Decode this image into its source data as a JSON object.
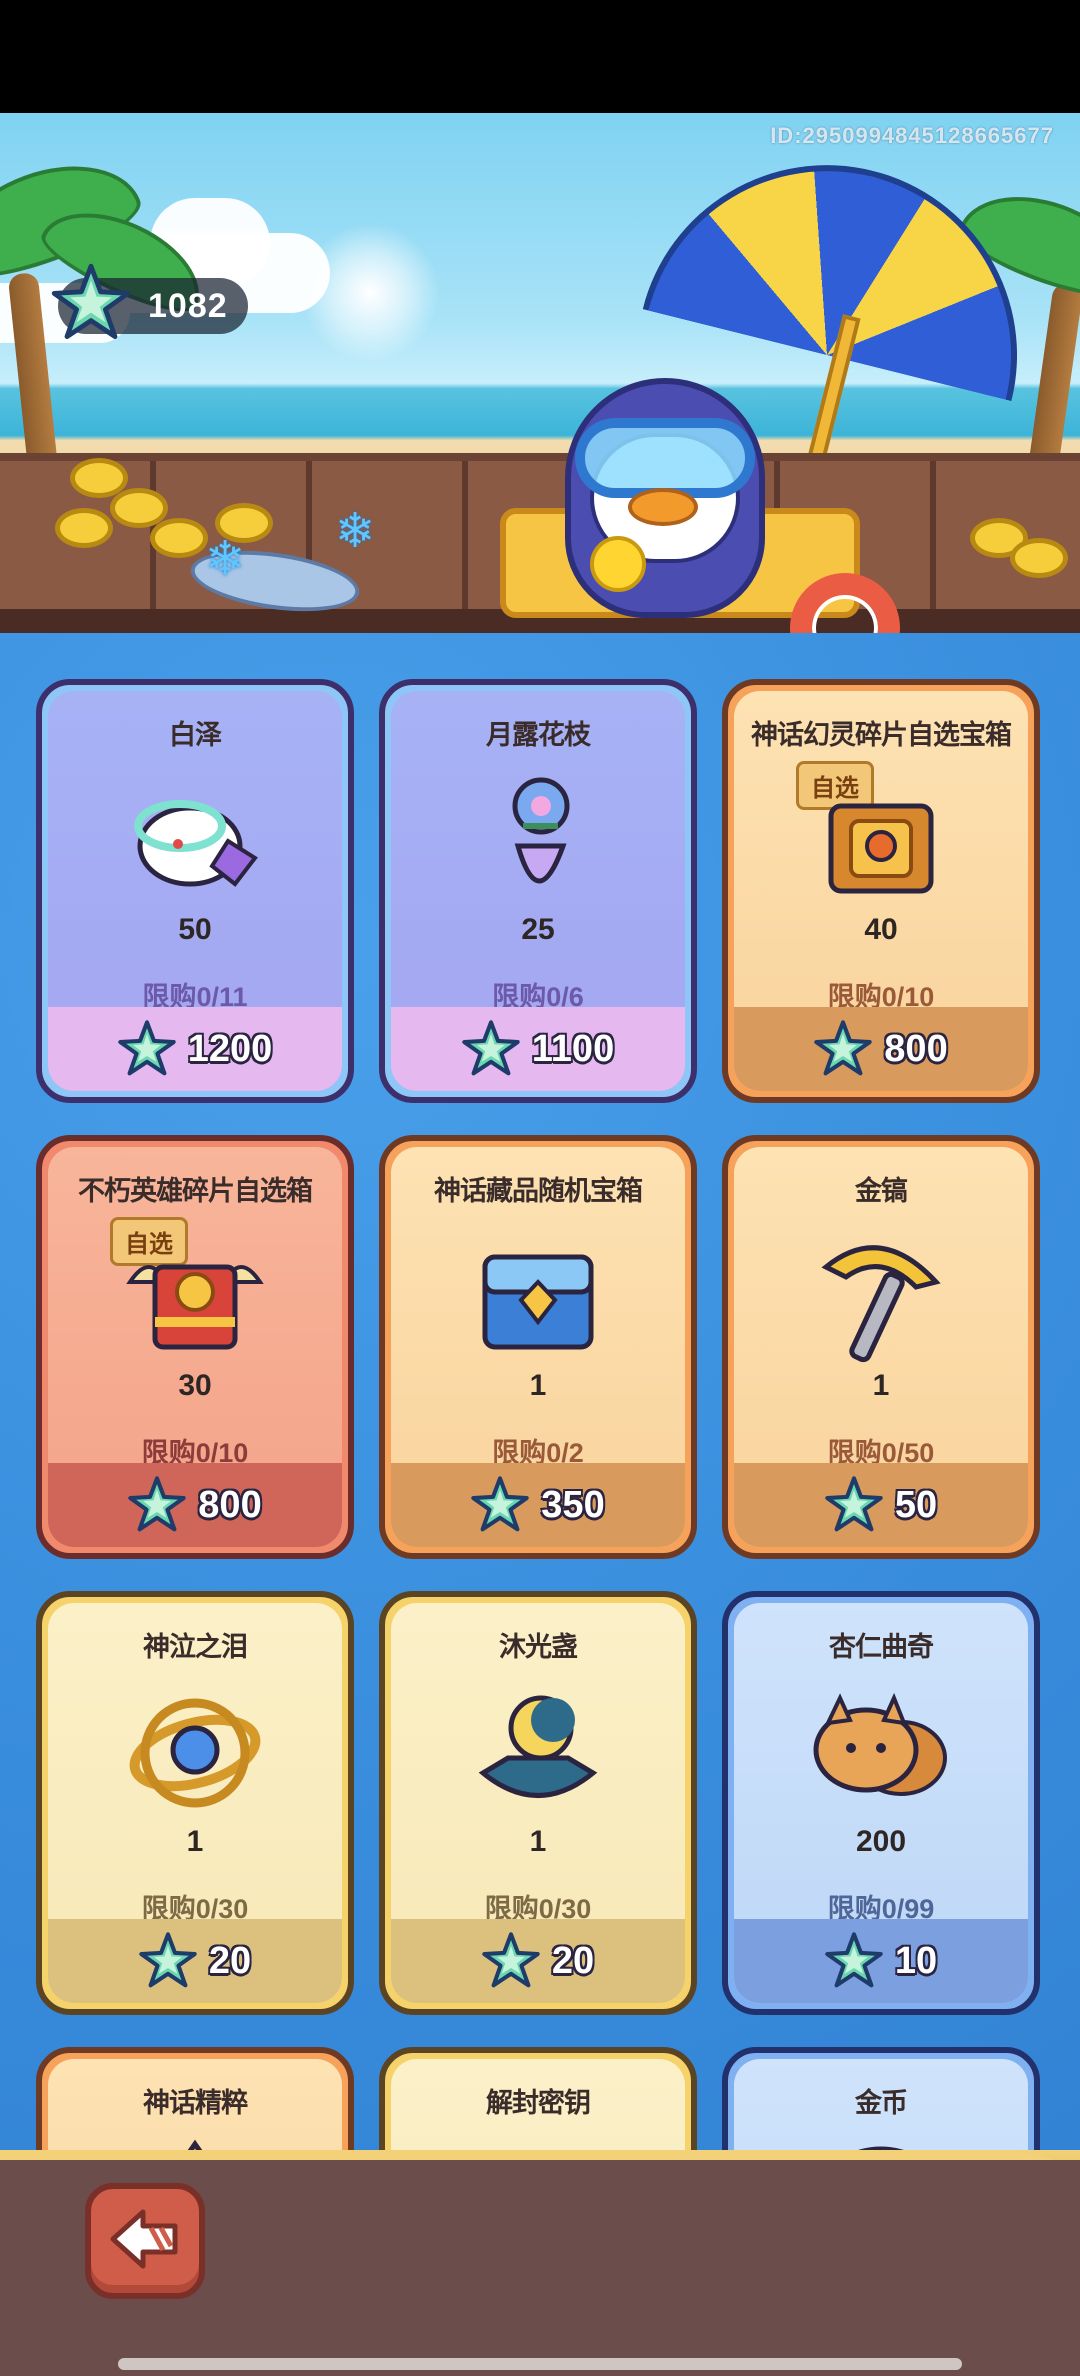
{
  "header": {
    "currency_value": "1082",
    "currency_icon": "starfish-icon",
    "player_id": "ID:2950994845128665677"
  },
  "shop": {
    "items": [
      {
        "name": "白泽",
        "qty": "50",
        "limit": "限购0/11",
        "price": "1200",
        "theme": "purple",
        "tag": "",
        "icon": "baize-creature-icon"
      },
      {
        "name": "月露花枝",
        "qty": "25",
        "limit": "限购0/6",
        "price": "1100",
        "theme": "purple",
        "tag": "",
        "icon": "flower-vase-icon"
      },
      {
        "name": "神话幻灵碎片自选宝箱",
        "qty": "40",
        "limit": "限购0/10",
        "price": "800",
        "theme": "orange",
        "tag": "自选",
        "icon": "chest-icon"
      },
      {
        "name": "不朽英雄碎片自选箱",
        "qty": "30",
        "limit": "限购0/10",
        "price": "800",
        "theme": "red",
        "tag": "自选",
        "icon": "winged-chest-icon"
      },
      {
        "name": "神话藏品随机宝箱",
        "qty": "1",
        "limit": "限购0/2",
        "price": "350",
        "theme": "orange",
        "tag": "",
        "icon": "blue-chest-icon"
      },
      {
        "name": "金镐",
        "qty": "1",
        "limit": "限购0/50",
        "price": "50",
        "theme": "orange",
        "tag": "",
        "icon": "golden-pickaxe-icon"
      },
      {
        "name": "神泣之泪",
        "qty": "1",
        "limit": "限购0/30",
        "price": "20",
        "theme": "yellow",
        "tag": "",
        "icon": "gem-ring-icon"
      },
      {
        "name": "沐光盏",
        "qty": "1",
        "limit": "限购0/30",
        "price": "20",
        "theme": "yellow",
        "tag": "",
        "icon": "moon-lamp-icon"
      },
      {
        "name": "杏仁曲奇",
        "qty": "200",
        "limit": "限购0/99",
        "price": "10",
        "theme": "blue",
        "tag": "",
        "icon": "cat-cookie-icon"
      },
      {
        "name": "神话精粹",
        "qty": "",
        "limit": "",
        "price": "",
        "theme": "orange",
        "tag": "",
        "icon": "essence-icon"
      },
      {
        "name": "解封密钥",
        "qty": "",
        "limit": "",
        "price": "",
        "theme": "yellow",
        "tag": "",
        "icon": "key-icon"
      },
      {
        "name": "金币",
        "qty": "",
        "limit": "",
        "price": "",
        "theme": "blue",
        "tag": "",
        "icon": "gold-coin-icon"
      }
    ]
  },
  "footer": {
    "back_icon": "back-arrow-icon"
  },
  "colors": {
    "shop_bg": "#3a8fde",
    "price_star": "#5fd1a8",
    "back_button": "#cf5d49"
  }
}
